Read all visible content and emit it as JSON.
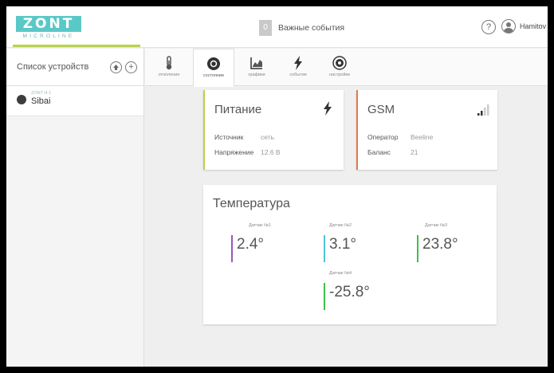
{
  "header": {
    "logo": {
      "main": "ZONT",
      "sub": "MICROLINE"
    },
    "events": {
      "count": "0",
      "label": "Важные события"
    },
    "help": "?",
    "user": "Hamitov"
  },
  "sidebar": {
    "title": "Список устройств",
    "devices": [
      {
        "model": "ZONT H-1",
        "name": "Sibai"
      }
    ]
  },
  "toolbar": {
    "tabs": [
      {
        "label": "отопление",
        "icon": "thermometer-icon"
      },
      {
        "label": "состояние",
        "icon": "state-icon",
        "active": true
      },
      {
        "label": "графики",
        "icon": "chart-icon"
      },
      {
        "label": "события",
        "icon": "lightning-icon"
      },
      {
        "label": "настройки",
        "icon": "gear-icon"
      }
    ]
  },
  "power": {
    "title": "Питание",
    "source_key": "Источник",
    "source_val": "сеть",
    "voltage_key": "Напряжение",
    "voltage_val": "12.6 В"
  },
  "gsm": {
    "title": "GSM",
    "operator_key": "Оператор",
    "operator_val": "Beeline",
    "balance_key": "Баланс",
    "balance_val": "21"
  },
  "temperature": {
    "title": "Температура",
    "sensors": [
      {
        "label": "Датчик №1",
        "value": "2.4°",
        "color": "#9b59b6"
      },
      {
        "label": "Датчик №2",
        "value": "3.1°",
        "color": "#4fc3d9"
      },
      {
        "label": "Датчик №3",
        "value": "23.8°",
        "color": "#3cc24a"
      },
      {
        "label": "Датчик №4",
        "value": "-25.8°",
        "color": "#3cc24a"
      }
    ]
  },
  "colors": {
    "brand": "#5bc8c8",
    "accent_green": "#b8d24a",
    "gsm_accent": "#e07a4e"
  }
}
